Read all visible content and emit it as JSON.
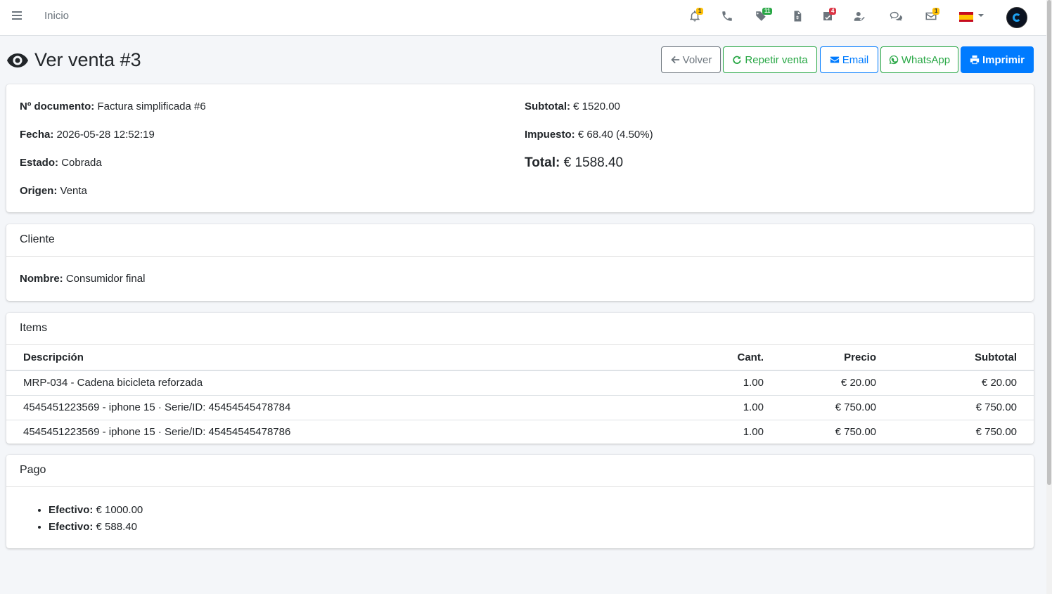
{
  "nav": {
    "home": "Inicio",
    "badges": {
      "bell": "1",
      "tags": "11",
      "tasks": "4",
      "mail": "1"
    }
  },
  "page": {
    "title": "Ver venta #3"
  },
  "actions": {
    "back": "Volver",
    "repeat": "Repetir venta",
    "email": "Email",
    "whatsapp": "WhatsApp",
    "print": "Imprimir"
  },
  "summary": {
    "doc_label": "Nº documento:",
    "doc_value": "Factura simplificada #6",
    "date_label": "Fecha:",
    "date_value": "2026-05-28 12:52:19",
    "status_label": "Estado:",
    "status_value": "Cobrada",
    "origin_label": "Origen:",
    "origin_value": "Venta",
    "subtotal_label": "Subtotal:",
    "subtotal_value": "€ 1520.00",
    "tax_label": "Impuesto:",
    "tax_value": "€ 68.40 (4.50%)",
    "total_label": "Total:",
    "total_value": "€ 1588.40"
  },
  "client": {
    "header": "Cliente",
    "name_label": "Nombre:",
    "name_value": "Consumidor final"
  },
  "items": {
    "header": "Items",
    "columns": [
      "Descripción",
      "Cant.",
      "Precio",
      "Subtotal"
    ],
    "rows": [
      [
        "MRP-034 - Cadena bicicleta reforzada",
        "1.00",
        "€ 20.00",
        "€ 20.00"
      ],
      [
        "4545451223569 - iphone 15 · Serie/ID: 45454545478784",
        "1.00",
        "€ 750.00",
        "€ 750.00"
      ],
      [
        "4545451223569 - iphone 15 · Serie/ID: 45454545478786",
        "1.00",
        "€ 750.00",
        "€ 750.00"
      ]
    ]
  },
  "payment": {
    "header": "Pago",
    "entries": [
      {
        "label": "Efectivo:",
        "value": "€ 1000.00"
      },
      {
        "label": "Efectivo:",
        "value": "€ 588.40"
      }
    ]
  }
}
